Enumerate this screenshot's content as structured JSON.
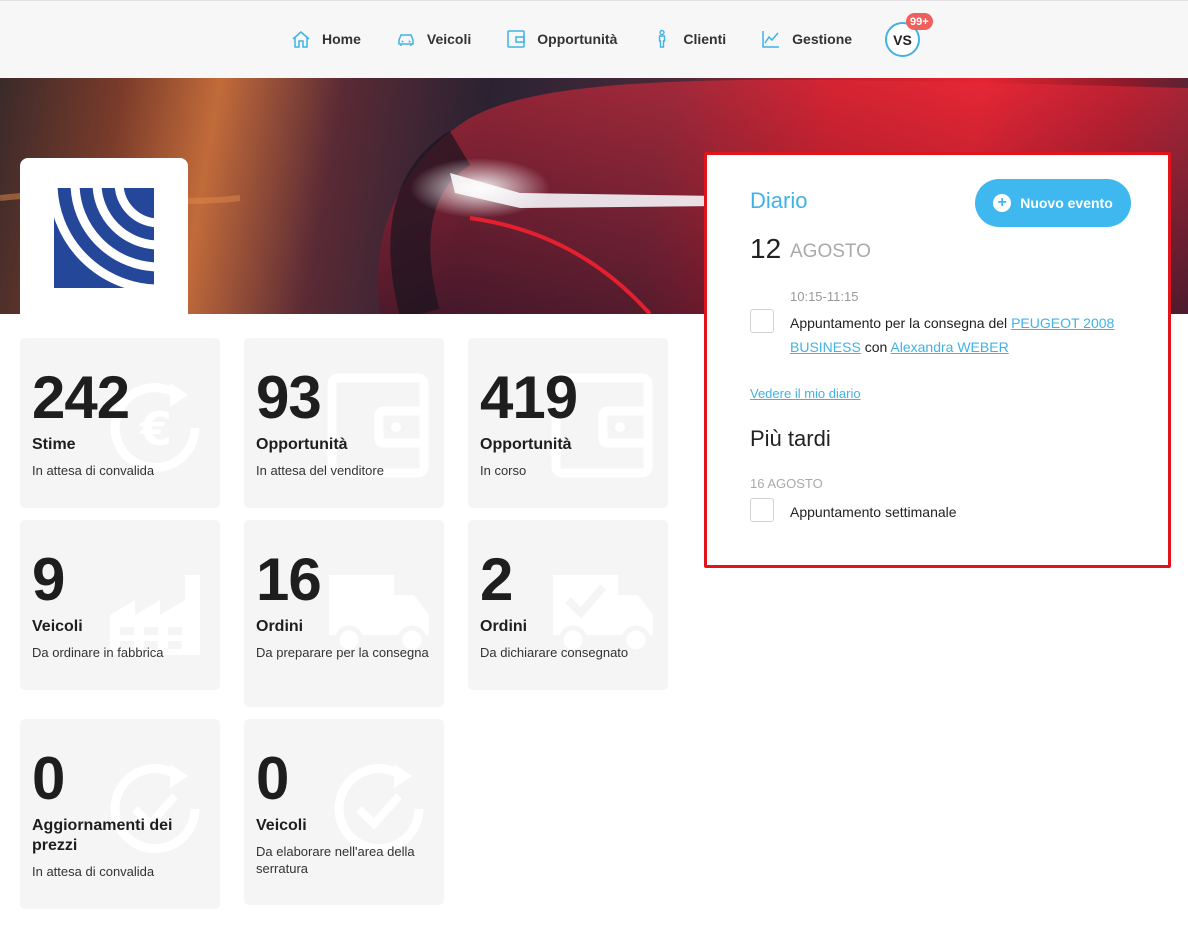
{
  "nav": {
    "items": [
      {
        "label": "Home",
        "icon": "home-icon"
      },
      {
        "label": "Veicoli",
        "icon": "car-icon"
      },
      {
        "label": "Opportunità",
        "icon": "wallet-icon"
      },
      {
        "label": "Clienti",
        "icon": "person-icon"
      },
      {
        "label": "Gestione",
        "icon": "chart-icon"
      }
    ],
    "avatar_initials": "VS",
    "notification_count": "99+"
  },
  "colors": {
    "accent": "#3fb3e6",
    "badge": "#f0605d",
    "highlight_border": "#e1141b",
    "logo_blue": "#24479a"
  },
  "cards": [
    {
      "number": "242",
      "title": "Stime",
      "subtitle": "In attesa di convalida",
      "icon": "euro-refresh-icon"
    },
    {
      "number": "93",
      "title": "Opportunità",
      "subtitle": "In attesa del venditore",
      "icon": "wallet-icon"
    },
    {
      "number": "419",
      "title": "Opportunità",
      "subtitle": "In corso",
      "icon": "wallet-icon"
    },
    {
      "number": "9",
      "title": "Veicoli",
      "subtitle": "Da ordinare in fabbrica",
      "icon": "factory-icon"
    },
    {
      "number": "16",
      "title": "Ordini",
      "subtitle": "Da preparare per la consegna",
      "icon": "truck-icon"
    },
    {
      "number": "2",
      "title": "Ordini",
      "subtitle": "Da dichiarare consegnato",
      "icon": "truck-check-icon"
    },
    {
      "number": "0",
      "title": "Aggiornamenti dei prezzi",
      "subtitle": "In attesa di convalida",
      "icon": "check-refresh-icon"
    },
    {
      "number": "0",
      "title": "Veicoli",
      "subtitle": "Da elaborare nell'area della serratura",
      "icon": "check-refresh-icon"
    }
  ],
  "diary": {
    "title": "Diario",
    "new_event_label": "Nuovo evento",
    "today": {
      "day": "12",
      "month": "AGOSTO"
    },
    "appointment": {
      "time": "10:15-11:15",
      "text_before": "Appuntamento per la consegna del",
      "vehicle_link": "PEUGEOT 2008 BUSINESS",
      "text_mid": "con",
      "client_link": "Alexandra WEBER"
    },
    "see_diary_link": "Vedere il mio diario",
    "later_title": "Più tardi",
    "later": {
      "date": "16 AGOSTO",
      "text": "Appuntamento settimanale"
    }
  }
}
